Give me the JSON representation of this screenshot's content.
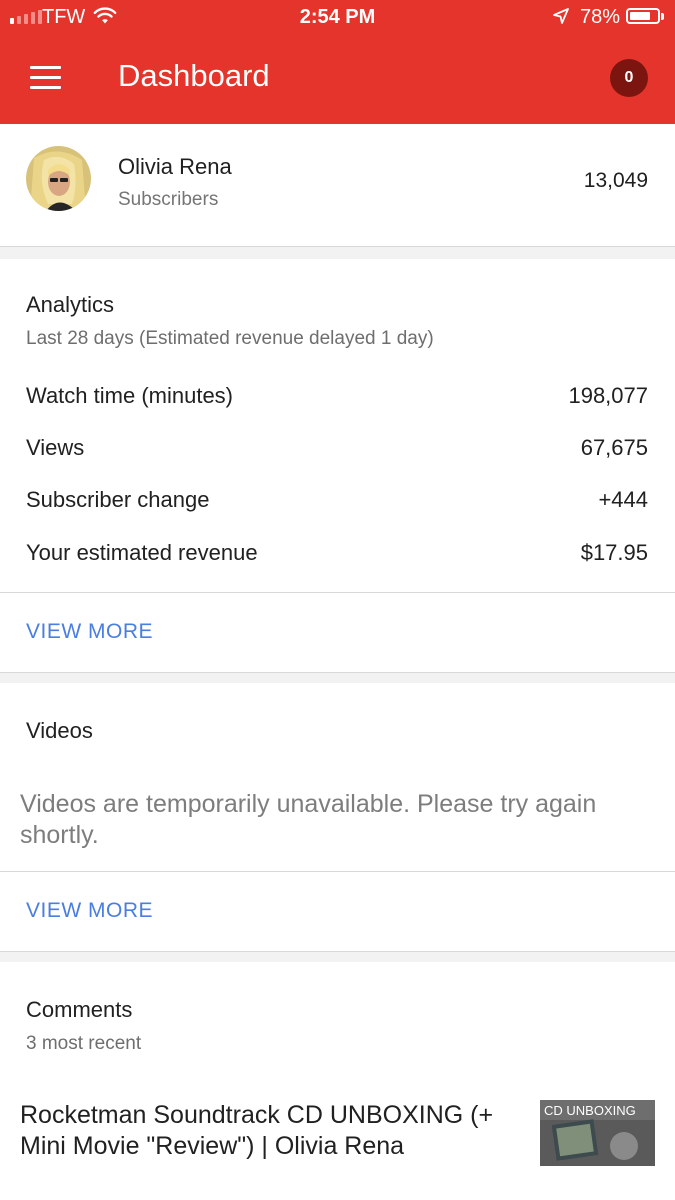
{
  "status_bar": {
    "carrier": "TFW",
    "time": "2:54 PM",
    "battery_percent": "78%",
    "battery_level": 0.78,
    "signal_bars_active": 1
  },
  "app_bar": {
    "title": "Dashboard",
    "notification_count": "0",
    "color": "#e4342b"
  },
  "channel": {
    "name": "Olivia Rena",
    "subscribers_label": "Subscribers",
    "subscriber_count": "13,049"
  },
  "analytics": {
    "title": "Analytics",
    "subtitle": "Last 28 days (Estimated revenue delayed 1 day)",
    "rows": [
      {
        "label": "Watch time (minutes)",
        "value": "198,077"
      },
      {
        "label": "Views",
        "value": "67,675"
      },
      {
        "label": "Subscriber change",
        "value": "+444"
      },
      {
        "label": "Your estimated revenue",
        "value": "$17.95"
      }
    ],
    "view_more": "VIEW MORE"
  },
  "videos": {
    "title": "Videos",
    "message": "Videos are temporarily unavailable. Please try again shortly.",
    "view_more": "VIEW MORE"
  },
  "comments": {
    "title": "Comments",
    "subtitle": "3 most recent",
    "items": [
      {
        "video_title": "Rocketman Soundtrack CD UNBOXING (+ Mini Movie \"Review\") | Olivia Rena",
        "thumbnail_text": "CD UNBOXING"
      }
    ]
  },
  "colors": {
    "accent": "#e4342b",
    "link": "#4a7ee0",
    "badge": "#7c1510"
  }
}
